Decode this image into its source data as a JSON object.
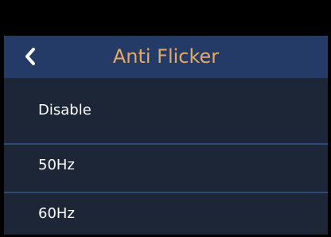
{
  "header": {
    "title": "Anti Flicker",
    "back_icon": "chevron-left-icon"
  },
  "options": [
    {
      "label": "Disable"
    },
    {
      "label": "50Hz"
    },
    {
      "label": "60Hz"
    }
  ],
  "colors": {
    "header_bg": "#233b66",
    "title_text": "#e8a860",
    "list_bg": "#1c2637",
    "divider": "#2b4a80",
    "item_text": "#ffffff"
  }
}
